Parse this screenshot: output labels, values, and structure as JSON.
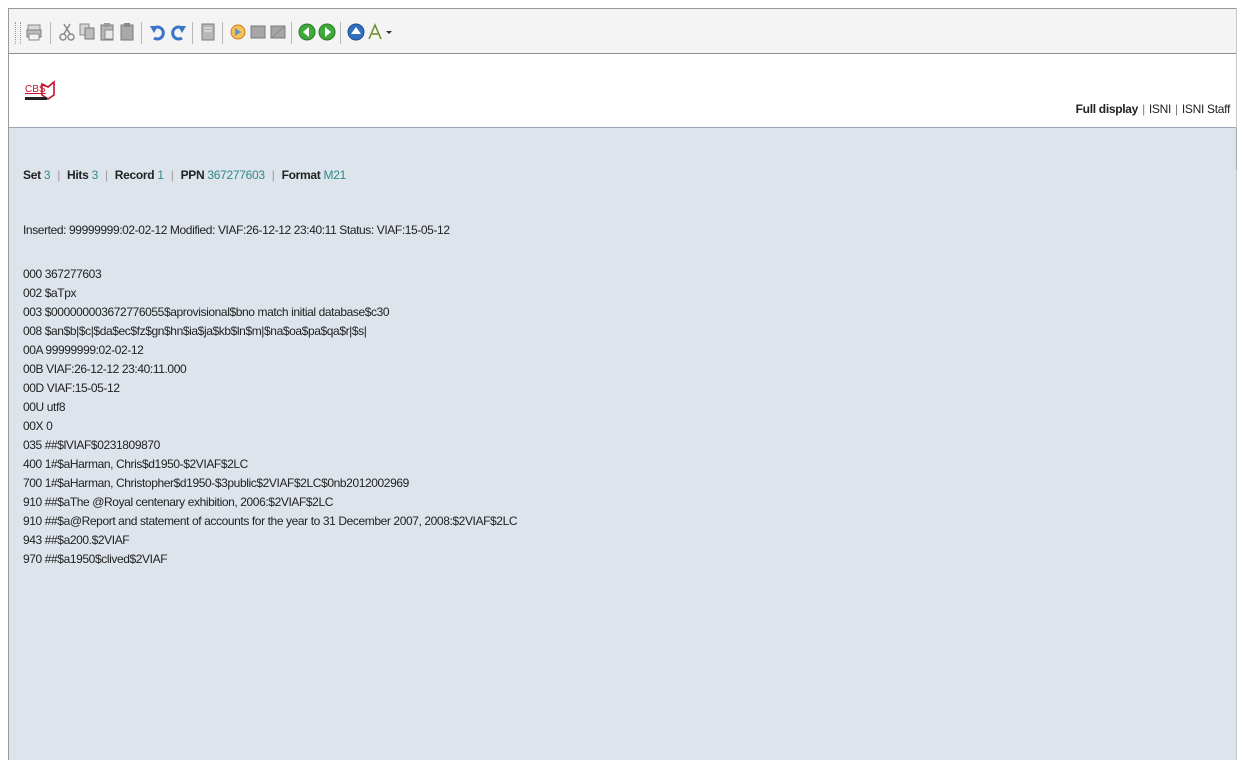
{
  "toolbar": {
    "buttons": [
      {
        "name": "print-icon"
      },
      {
        "name": "cut-icon"
      },
      {
        "name": "copy-icon"
      },
      {
        "name": "paste-icon"
      },
      {
        "name": "paste-special-icon"
      },
      {
        "name": "undo-icon"
      },
      {
        "name": "redo-icon"
      },
      {
        "name": "page-icon"
      },
      {
        "name": "refresh-icon"
      },
      {
        "name": "panel-icon"
      },
      {
        "name": "panel-alt-icon"
      },
      {
        "name": "back-icon"
      },
      {
        "name": "forward-icon"
      },
      {
        "name": "up-icon"
      },
      {
        "name": "text-tool-icon"
      }
    ]
  },
  "header": {
    "logo_text": "CBS",
    "nav": {
      "full_display": "Full display",
      "isni": "ISNI",
      "isni_staff": "ISNI Staff",
      "separator": "|"
    }
  },
  "status": {
    "set_label": "Set",
    "set_value": "3",
    "hits_label": "Hits",
    "hits_value": "3",
    "record_label": "Record",
    "record_value": "1",
    "ppn_label": "PPN",
    "ppn_value": "367277603",
    "format_label": "Format",
    "format_value": "M21",
    "separator": "|"
  },
  "record": {
    "inserted_line": "Inserted: 99999999:02-02-12 Modified: VIAF:26-12-12 23:40:11 Status: VIAF:15-05-12",
    "fields": [
      "000 367277603",
      "002 $aTpx",
      "003 $000000003672776055$aprovisional$bno match initial database$c30",
      "008 $an$b|$c|$da$ec$fz$gn$hn$ia$ja$kb$ln$m|$na$oa$pa$qa$r|$s|",
      "00A 99999999:02-02-12",
      "00B VIAF:26-12-12 23:40:11.000",
      "00D VIAF:15-05-12",
      "00U utf8",
      "00X 0",
      "035 ##$lVIAF$0231809870",
      "400 1#$aHarman, Chris$d1950-$2VIAF$2LC",
      "700 1#$aHarman, Christopher$d1950-$3public$2VIAF$2LC$0nb2012002969",
      "910 ##$aThe @Royal centenary exhibition, 2006:$2VIAF$2LC",
      "910 ##$a@Report and statement of accounts for the year to 31 December 2007, 2008:$2VIAF$2LC",
      "943 ##$a200.$2VIAF",
      "970 ##$a1950$clived$2VIAF"
    ]
  }
}
